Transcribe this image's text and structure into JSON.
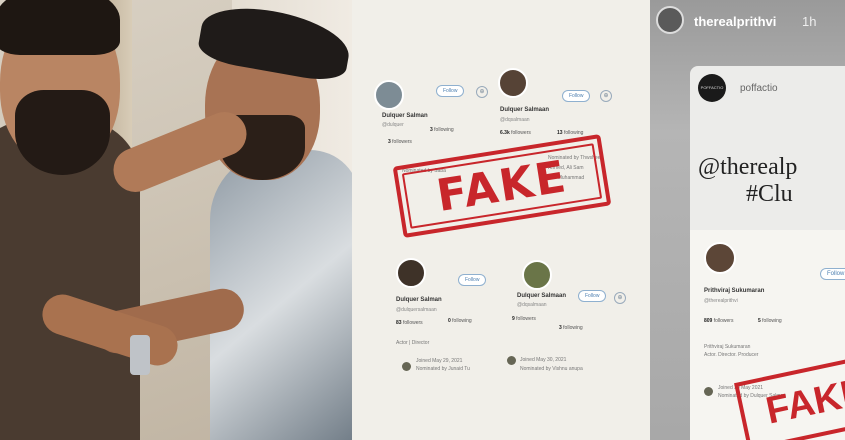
{
  "mid": {
    "cards": [
      {
        "name": "Dulquer Salman",
        "handle": "@dulquer",
        "followers": "3",
        "followers_label": "followers",
        "following": "3",
        "following_label": "following",
        "follow": "Follow"
      },
      {
        "name": "Dulquer Salmaan",
        "handle": "@dqsalmaan",
        "followers": "6.3k",
        "followers_label": "followers",
        "following": "13",
        "following_label": "following",
        "follow": "Follow"
      },
      {
        "name": "Dulquer Salman",
        "handle": "@dulquersalmaan",
        "followers": "83",
        "followers_label": "followers",
        "following": "0",
        "following_label": "following",
        "follow": "Follow",
        "bio": "Actor | Director",
        "joined": "Joined May 29, 2021",
        "nominated": "Nominated by Junaid Tu"
      },
      {
        "name": "Dulquer Salmaan",
        "handle": "@dqsalmaan",
        "followers": "9",
        "followers_label": "followers",
        "following": "3",
        "following_label": "following",
        "follow": "Follow",
        "joined": "Joined May 30, 2021",
        "nominated": "Nominated by Vishnu anupa"
      }
    ],
    "overlap_text1": "Nominated by Thwsheer",
    "overlap_text2": "Ahmed, Ali Sam",
    "overlap_text3": "Adil Muhammad",
    "stamp": "FAKE"
  },
  "story": {
    "username": "therealprithvi",
    "time": "1h",
    "post_author": "poffactio",
    "post_avatar_text": "POFFACTIO",
    "post_line1": "@therealp",
    "post_line2": "#Clu",
    "card": {
      "follow": "Follow",
      "name": "Prithviraj Sukumaran",
      "handle": "@therealprithvi",
      "followers": "809",
      "followers_label": "followers",
      "following": "5",
      "following_label": "following",
      "bio1": "Prithviraj Sukumaran",
      "bio2": "Actor. Director. Producer",
      "joined": "Joined 30 May 2021",
      "nominated": "Nominated by Dulquer Salman"
    },
    "stamp": "FAKE"
  }
}
